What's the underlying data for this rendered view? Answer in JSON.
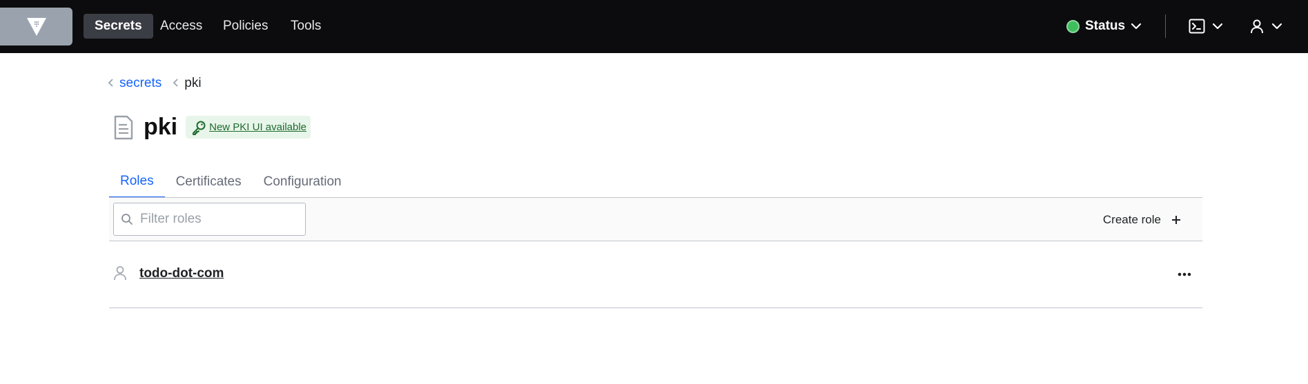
{
  "topnav": {
    "logo_icon": "vault-logo-icon",
    "items": [
      {
        "label": "Secrets",
        "active": true
      },
      {
        "label": "Access",
        "active": false
      },
      {
        "label": "Policies",
        "active": false
      },
      {
        "label": "Tools",
        "active": false
      }
    ],
    "status_label": "Status",
    "status_color": "#3fbf5c"
  },
  "breadcrumb": {
    "parent": "secrets",
    "current": "pki"
  },
  "page": {
    "title": "pki",
    "title_icon": "document-icon",
    "badge_label": "New PKI UI available",
    "badge_icon": "key-icon"
  },
  "tabs": [
    {
      "label": "Roles",
      "active": true
    },
    {
      "label": "Certificates",
      "active": false
    },
    {
      "label": "Configuration",
      "active": false
    }
  ],
  "toolbar": {
    "filter_placeholder": "Filter roles",
    "create_label": "Create role"
  },
  "roles": [
    {
      "name": "todo-dot-com",
      "icon": "user-icon"
    }
  ],
  "colors": {
    "accent": "#1563ff",
    "nav_bg": "#0c0c0e",
    "badge_bg": "#e8f5ea",
    "badge_text": "#1e6b2e"
  }
}
